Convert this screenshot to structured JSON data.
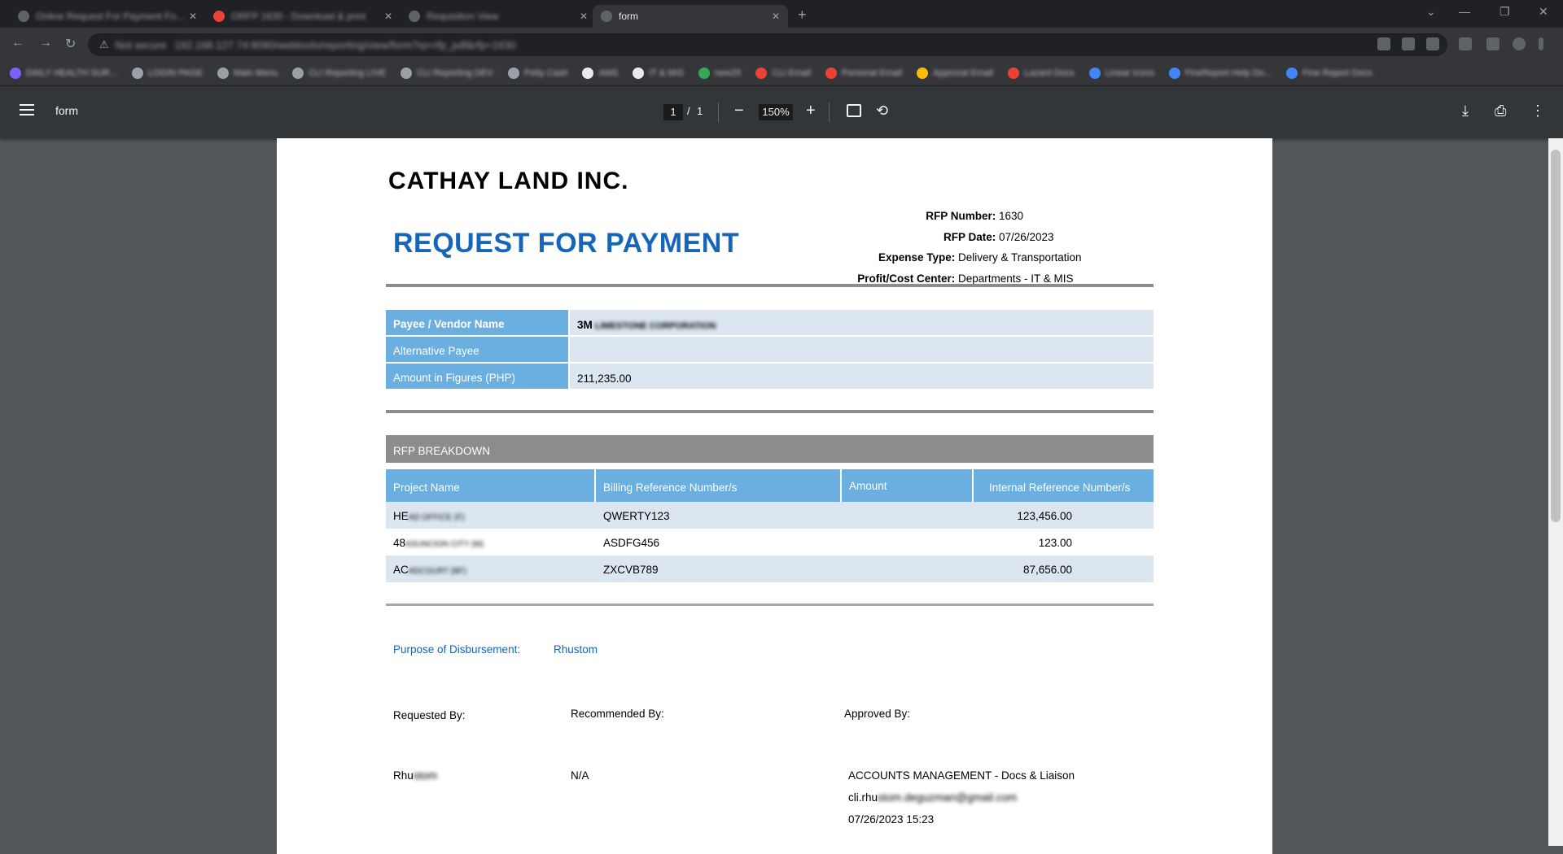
{
  "browser": {
    "tabs": [
      {
        "title": "Online Request For Payment Fo..."
      },
      {
        "title": "ORFP 1630 - Download & print"
      },
      {
        "title": "Requisition View"
      },
      {
        "title": "form"
      }
    ],
    "url_prefix": "Not secure",
    "url": "192.168.127.74:8080/webtools/reporting/view/form?rp=rfp_pdf&rfp=1630",
    "bookmarks": [
      {
        "label": "DAILY HEALTH SUR...",
        "color": "#7b61ff"
      },
      {
        "label": "LOGIN PAGE",
        "color": "#9aa0a6"
      },
      {
        "label": "Main Menu",
        "color": "#9aa0a6"
      },
      {
        "label": "CLI Reporting LIVE",
        "color": "#9aa0a6"
      },
      {
        "label": "CLI Reporting DEV",
        "color": "#9aa0a6"
      },
      {
        "label": "Petty Cash",
        "color": "#9aa0a6"
      },
      {
        "label": "AMS",
        "color": "#e8eaed"
      },
      {
        "label": "IT & MIS",
        "color": "#e8eaed"
      },
      {
        "label": "new25",
        "color": "#34a853"
      },
      {
        "label": "CLI Email",
        "color": "#ea4335"
      },
      {
        "label": "Personal Email",
        "color": "#ea4335"
      },
      {
        "label": "Approval Email",
        "color": "#fbbc04"
      },
      {
        "label": "Lazard Docs",
        "color": "#ea4335"
      },
      {
        "label": "Linear Icons",
        "color": "#4285f4"
      },
      {
        "label": "FineReport Help Do...",
        "color": "#4285f4"
      },
      {
        "label": "Fine Report Docs",
        "color": "#4285f4"
      }
    ]
  },
  "viewer": {
    "title": "form",
    "page_current": "1",
    "page_sep": "/",
    "page_total": "1",
    "zoom": "150%"
  },
  "doc": {
    "company": "CATHAY LAND INC.",
    "title": "REQUEST FOR PAYMENT",
    "meta": {
      "rfp_number_label": "RFP Number:",
      "rfp_number": "1630",
      "rfp_date_label": "RFP Date:",
      "rfp_date": "07/26/2023",
      "expense_type_label": "Expense Type:",
      "expense_type": "Delivery & Transportation",
      "cost_center_label": "Profit/Cost Center:",
      "cost_center": "Departments - IT & MIS"
    },
    "vendor": {
      "payee_label": "Payee / Vendor Name",
      "payee_visible": "3M",
      "payee_redacted": "LIMESTONE CORPORATION",
      "alt_payee_label": "Alternative Payee",
      "alt_payee": "",
      "amount_label": "Amount in Figures (PHP)",
      "amount": "211,235.00"
    },
    "breakdown": {
      "heading": "RFP BREAKDOWN",
      "columns": [
        "Project Name",
        "Billing Reference Number/s",
        "Amount",
        "Internal Reference Number/s"
      ],
      "rows": [
        {
          "project_visible": "HE",
          "project_redacted": "AD OFFICE (F)",
          "billing": "QWERTY123",
          "amount": "123,456.00",
          "internal": ""
        },
        {
          "project_visible": "48",
          "project_redacted": "ASUNCION CITY (M)",
          "billing": "ASDFG456",
          "amount": "123.00",
          "internal": ""
        },
        {
          "project_visible": "AC",
          "project_redacted": "ADCOURT (BF)",
          "billing": "ZXCVB789",
          "amount": "87,656.00",
          "internal": ""
        }
      ]
    },
    "purpose_label": "Purpose of Disbursement:",
    "purpose": "Rhustom",
    "signatures": {
      "requested_label": "Requested By:",
      "recommended_label": "Recommended By:",
      "approved_label": "Approved By:",
      "requested_visible": "Rhu",
      "requested_redacted": "stom",
      "recommended": "N/A",
      "approved_name": "ACCOUNTS MANAGEMENT - Docs & Liaison",
      "approved_email_visible": "cli.rhu",
      "approved_email_redacted": "stom.deguzman@gmail.com",
      "approved_datetime": "07/26/2023 15:23"
    }
  }
}
